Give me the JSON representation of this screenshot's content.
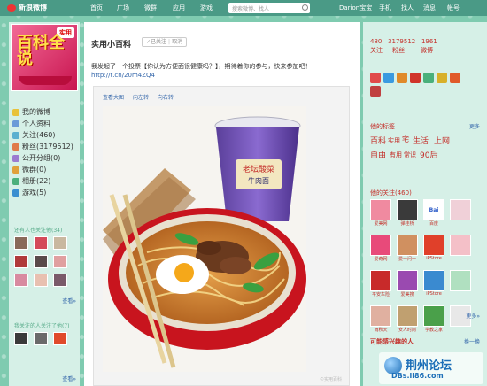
{
  "nav": {
    "logo": "新浪微博",
    "items": [
      "首页",
      "广场",
      "微群",
      "应用",
      "游戏"
    ],
    "search_placeholder": "搜索微博、找人",
    "user": "Darion宝宝",
    "right_items": [
      "手机",
      "找人",
      "消息",
      "帐号"
    ]
  },
  "left": {
    "avatar_big": "百科全说",
    "avatar_tag": "实用",
    "menu": [
      "我的微博",
      "个人资料",
      "关注(460)",
      "粉丝(3179512)",
      "公开分组(0)",
      "微群(0)",
      "相册(22)",
      "游戏(5)"
    ],
    "section1_title": "还有人也关注他(34)",
    "section1_more": "查看»",
    "section2_title": "我关注的人关注了他(7)",
    "section2_more": "查看»"
  },
  "main": {
    "title": "实用小百科",
    "follow_label": "已关注",
    "cancel_label": "取消",
    "post_text": "我发起了一个投票【你认为方便面很健康吗？】，期待着你的参与，快来参加吧！",
    "post_link": "http://t.cn/20m4ZQ4",
    "tools": [
      "查看大图",
      "向左转",
      "向右转"
    ],
    "watermark": "©实用百科",
    "cup_text_1": "老坛酸菜",
    "cup_text_2": "牛肉面"
  },
  "right": {
    "stats": [
      "480",
      "3179512",
      "1961"
    ],
    "stat_labels": [
      "关注",
      "粉丝",
      "微博"
    ],
    "tags_title": "他的标签",
    "tags_more": "更多",
    "tags": [
      {
        "text": "百科",
        "size": 9
      },
      {
        "text": "实用",
        "size": 7
      },
      {
        "text": "宅",
        "size": 8
      },
      {
        "text": "生活",
        "size": 9
      },
      {
        "text": "上网",
        "size": 9
      },
      {
        "text": "自由",
        "size": 9
      },
      {
        "text": "有用",
        "size": 7
      },
      {
        "text": "常识",
        "size": 7
      },
      {
        "text": "90后",
        "size": 9
      }
    ],
    "follows_title": "他的关注",
    "follows_count": "(460)",
    "follows": [
      "爱美网",
      "弹桂桥",
      "百度",
      "",
      "爱奇网",
      "爱一问一",
      "iPStore",
      "",
      "平安车险",
      "爱美搜",
      "iPStore",
      "",
      "雨秋天",
      "女人时尚",
      "学教之家",
      ""
    ],
    "follows_more": "更多»",
    "maybe_title": "可能感兴趣的人",
    "maybe_more": "换一换",
    "bottom_logo_big": "荆州论坛",
    "bottom_logo_url": "DBs.ii86.com"
  },
  "colors": {
    "accent": "#c4302b",
    "nav_bg": "#4a9a86",
    "page_bg": "#7fcbb0"
  }
}
